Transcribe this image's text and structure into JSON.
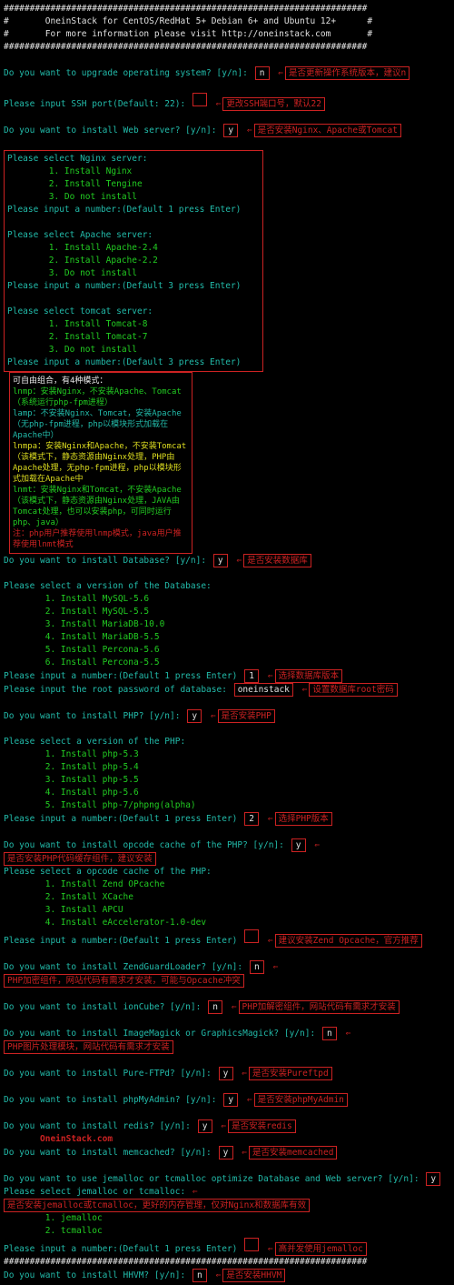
{
  "hash": "######################################################################",
  "hdr1": "#       OneinStack for CentOS/RedHat 5+ Debian 6+ and Ubuntu 12+      #",
  "hdr2": "#       For more information please visit http://oneinstack.com       #",
  "q": {
    "upgrade": "Do you want to upgrade operating system? [y/n]:",
    "upgrade_v": "n",
    "upgrade_ann": "是否更新操作系统版本，建议n",
    "ssh": "Please input SSH port(Default: 22):",
    "ssh_v": "",
    "ssh_ann": "更改SSH端口号，默认22",
    "web": "Do you want to install Web server? [y/n]:",
    "web_v": "y",
    "web_ann": "是否安装Nginx、Apache或Tomcat",
    "nginx_hdr": "Please select Nginx server:",
    "nginx_opts": [
      "1. Install Nginx",
      "2. Install Tengine",
      "3. Do not install"
    ],
    "nginx_in": "Please input a number:(Default 1 press Enter)",
    "apache_hdr": "Please select Apache server:",
    "apache_opts": [
      "1. Install Apache-2.4",
      "2. Install Apache-2.2",
      "3. Do not install"
    ],
    "apache_in": "Please input a number:(Default 3 press Enter)",
    "tomcat_hdr": "Please select tomcat server:",
    "tomcat_opts": [
      "1. Install Tomcat-8",
      "2. Install Tomcat-7",
      "3. Do not install"
    ],
    "tomcat_in": "Please input a number:(Default 3 press Enter)",
    "db": "Do you want to install Database? [y/n]:",
    "db_v": "y",
    "db_ann": "是否安装数据库",
    "dbver_hdr": "Please select a version of the Database:",
    "dbver_opts": [
      "1. Install MySQL-5.6",
      "2. Install MySQL-5.5",
      "3. Install MariaDB-10.0",
      "4. Install MariaDB-5.5",
      "5. Install Percona-5.6",
      "6. Install Percona-5.5"
    ],
    "dbver_in": "Please input a number:(Default 1 press Enter)",
    "dbver_v": "1",
    "dbver_ann": "选择数据库版本",
    "dbpw": "Please input the root password of database:",
    "dbpw_v": "oneinstack",
    "dbpw_ann": "设置数据库root密码",
    "php": "Do you want to install PHP? [y/n]:",
    "php_v": "y",
    "php_ann": "是否安装PHP",
    "phpver_hdr": "Please select a version of the PHP:",
    "phpver_opts": [
      "1. Install php-5.3",
      "2. Install php-5.4",
      "3. Install php-5.5",
      "4. Install php-5.6",
      "5. Install php-7/phpng(alpha)"
    ],
    "phpver_in": "Please input a number:(Default 1 press Enter)",
    "phpver_v": "2",
    "phpver_ann": "选择PHP版本",
    "opcache": "Do you want to install opcode cache of the PHP? [y/n]:",
    "opcache_v": "y",
    "opcache_ann": "是否安装PHP代码缓存组件，建议安装",
    "opsel_hdr": "Please select a opcode cache of the PHP:",
    "opsel_opts": [
      "1. Install Zend OPcache",
      "2. Install XCache",
      "3. Install APCU",
      "4. Install eAccelerator-1.0-dev"
    ],
    "opsel_in": "Please input a number:(Default 1 press Enter)",
    "opsel_v": "",
    "opsel_ann": "建议安装Zend Opcache，官方推荐",
    "zgl": "Do you want to install ZendGuardLoader? [y/n]:",
    "zgl_v": "n",
    "zgl_ann": "PHP加密组件，网站代码有需求才安装，可能与Opcache冲突",
    "ion": "Do you want to install ionCube? [y/n]:",
    "ion_v": "n",
    "ion_ann": "PHP加解密组件，网站代码有需求才安装",
    "img": "Do you want to install ImageMagick or GraphicsMagick? [y/n]:",
    "img_v": "n",
    "img_ann": "PHP图片处理模块，网站代码有需求才安装",
    "ftp": "Do you want to install Pure-FTPd? [y/n]:",
    "ftp_v": "y",
    "ftp_ann": "是否安装Pureftpd",
    "pma": "Do you want to install phpMyAdmin? [y/n]:",
    "pma_v": "y",
    "pma_ann": "是否安装phpMyAdmin",
    "redis": "Do you want to install redis? [y/n]:",
    "redis_v": "y",
    "redis_ann": "是否安装redis",
    "memc": "Do you want to install memcached? [y/n]:",
    "memc_v": "y",
    "memc_ann": "是否安装memcached",
    "jem": "Do you want to use jemalloc or tcmalloc optimize Database and Web server? [y/n]:",
    "jem_v": "y",
    "jem_ann": "是否安装jemalloc或tcmalloc，更好的内存管理，仅对Nginx和数据库有效",
    "jemsel": "Please select jemalloc or tcmalloc:",
    "jemopts": [
      "1. jemalloc",
      "2. tcmalloc"
    ],
    "jemin": "Please input a number:(Default 1 press Enter)",
    "jemin_v": "",
    "jemin_ann": "高并发使用jemalloc",
    "hhvm": "Do you want to install HHVM? [y/n]:",
    "hhvm_v": "n",
    "hhvm_ann": "是否安装HHVM"
  },
  "side": {
    "h": "可自由组合，有4种模式：",
    "l1a": "lnmp：安装Nginx，不安装Apache、Tomcat（系统运行php-fpm进程）",
    "l2": "lamp：不安装Nginx、Tomcat，安装Apache（无php-fpm进程，php以模块形式加载在Apache中）",
    "l3": "lnmpa：安装Nginx和Apache，不安装Tomcat（该模式下，静态资源由Nginx处理，PHP由Apache处理，无php-fpm进程，php以模块形式加载在Apache中",
    "l4": "lnmt：安装Nginx和Tomcat，不安装Apache（该模式下，静态资源由Nginx处理，JAVA由Tomcat处理，也可以安装php，可同时运行php、java）",
    "l5": "注：php用户推荐使用lnmp模式，java用户推荐使用lnmt模式"
  },
  "url": "OneinStack.com"
}
